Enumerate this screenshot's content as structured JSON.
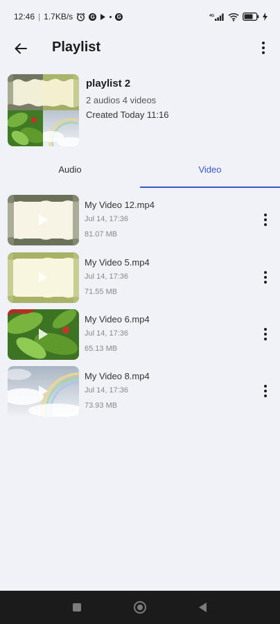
{
  "status_bar": {
    "time": "12:46",
    "speed": "1.7KB/s",
    "signal": "4G",
    "battery": "70%"
  },
  "app_bar": {
    "title": "Playlist"
  },
  "playlist": {
    "name": "playlist 2",
    "counts": "2 audios 4 videos",
    "created": "Created Today 11:16"
  },
  "tabs": [
    {
      "label": "Audio",
      "selected": false
    },
    {
      "label": "Video",
      "selected": true
    }
  ],
  "colors": {
    "accent": "#3a55c9",
    "background": "#f0f2f8"
  },
  "videos": [
    {
      "name": "My Video 12.mp4",
      "date": "Jul 14, 17:36",
      "size": "81.07 MB",
      "thumbnail": "ornate-frame-gray"
    },
    {
      "name": "My Video 5.mp4",
      "date": "Jul 14, 17:36",
      "size": "71.55 MB",
      "thumbnail": "ornate-frame-green"
    },
    {
      "name": "My Video 6.mp4",
      "date": "Jul 14, 17:36",
      "size": "65.13 MB",
      "thumbnail": "leaves-red-berry"
    },
    {
      "name": "My Video 8.mp4",
      "date": "Jul 14, 17:36",
      "size": "73.93 MB",
      "thumbnail": "rainbow-clouds"
    }
  ]
}
